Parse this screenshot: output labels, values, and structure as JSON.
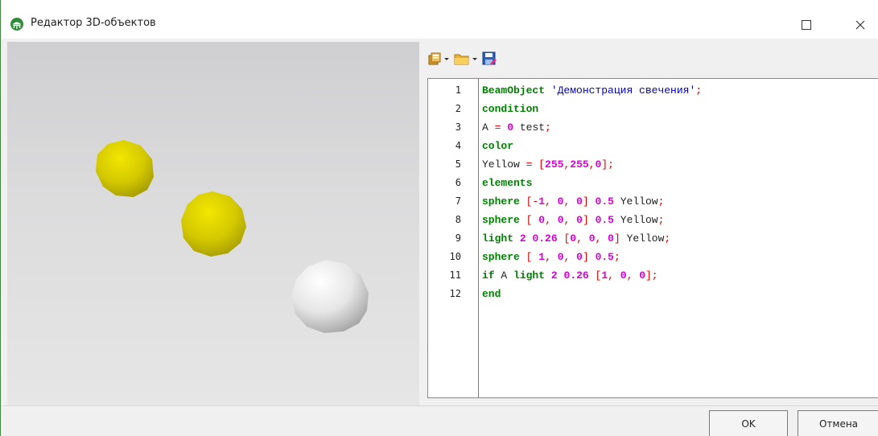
{
  "window": {
    "title": "Редактор 3D-объектов",
    "icons": {
      "app": "app-logo-icon",
      "maximize": "maximize-icon",
      "close": "close-icon"
    }
  },
  "scene": {
    "background": "#d8d8d9",
    "spheres": [
      {
        "label": "sphere-1",
        "color": "#d4c900"
      },
      {
        "label": "sphere-2",
        "color": "#d4c900"
      },
      {
        "label": "sphere-3",
        "color": "#ececec"
      }
    ]
  },
  "toolbar": {
    "items": [
      {
        "icon": "paste-templates-icon",
        "has_dropdown": true
      },
      {
        "icon": "open-folder-icon",
        "has_dropdown": true
      },
      {
        "icon": "save-icon",
        "has_dropdown": false
      }
    ]
  },
  "editor": {
    "line_numbers": [
      "1",
      "2",
      "3",
      "4",
      "5",
      "6",
      "7",
      "8",
      "9",
      "10",
      "11",
      "12"
    ],
    "lines": [
      [
        {
          "t": "kw",
          "v": "BeamObject"
        },
        {
          "t": "id",
          "v": " "
        },
        {
          "t": "str",
          "v": "'Демонстрация свечения'"
        },
        {
          "t": "op",
          "v": ";"
        }
      ],
      [
        {
          "t": "kw",
          "v": "condition"
        }
      ],
      [
        {
          "t": "id",
          "v": "A "
        },
        {
          "t": "op",
          "v": "="
        },
        {
          "t": "id",
          "v": " "
        },
        {
          "t": "num",
          "v": "0"
        },
        {
          "t": "id",
          "v": " test"
        },
        {
          "t": "op",
          "v": ";"
        }
      ],
      [
        {
          "t": "kw",
          "v": "color"
        }
      ],
      [
        {
          "t": "id",
          "v": "Yellow "
        },
        {
          "t": "op",
          "v": "="
        },
        {
          "t": "id",
          "v": " "
        },
        {
          "t": "op",
          "v": "["
        },
        {
          "t": "num",
          "v": "255"
        },
        {
          "t": "op",
          "v": ","
        },
        {
          "t": "num",
          "v": "255"
        },
        {
          "t": "op",
          "v": ","
        },
        {
          "t": "num",
          "v": "0"
        },
        {
          "t": "op",
          "v": "];"
        }
      ],
      [
        {
          "t": "kw",
          "v": "elements"
        }
      ],
      [
        {
          "t": "kw",
          "v": "sphere"
        },
        {
          "t": "id",
          "v": " "
        },
        {
          "t": "op",
          "v": "[-"
        },
        {
          "t": "num",
          "v": "1"
        },
        {
          "t": "op",
          "v": ","
        },
        {
          "t": "id",
          "v": " "
        },
        {
          "t": "num",
          "v": "0"
        },
        {
          "t": "op",
          "v": ","
        },
        {
          "t": "id",
          "v": " "
        },
        {
          "t": "num",
          "v": "0"
        },
        {
          "t": "op",
          "v": "]"
        },
        {
          "t": "id",
          "v": " "
        },
        {
          "t": "num",
          "v": "0.5"
        },
        {
          "t": "id",
          "v": " Yellow"
        },
        {
          "t": "op",
          "v": ";"
        }
      ],
      [
        {
          "t": "kw",
          "v": "sphere"
        },
        {
          "t": "id",
          "v": " "
        },
        {
          "t": "op",
          "v": "["
        },
        {
          "t": "id",
          "v": " "
        },
        {
          "t": "num",
          "v": "0"
        },
        {
          "t": "op",
          "v": ","
        },
        {
          "t": "id",
          "v": " "
        },
        {
          "t": "num",
          "v": "0"
        },
        {
          "t": "op",
          "v": ","
        },
        {
          "t": "id",
          "v": " "
        },
        {
          "t": "num",
          "v": "0"
        },
        {
          "t": "op",
          "v": "]"
        },
        {
          "t": "id",
          "v": " "
        },
        {
          "t": "num",
          "v": "0.5"
        },
        {
          "t": "id",
          "v": " Yellow"
        },
        {
          "t": "op",
          "v": ";"
        }
      ],
      [
        {
          "t": "kw",
          "v": "light"
        },
        {
          "t": "id",
          "v": " "
        },
        {
          "t": "num",
          "v": "2"
        },
        {
          "t": "id",
          "v": " "
        },
        {
          "t": "num",
          "v": "0.26"
        },
        {
          "t": "id",
          "v": " "
        },
        {
          "t": "op",
          "v": "["
        },
        {
          "t": "num",
          "v": "0"
        },
        {
          "t": "op",
          "v": ","
        },
        {
          "t": "id",
          "v": " "
        },
        {
          "t": "num",
          "v": "0"
        },
        {
          "t": "op",
          "v": ","
        },
        {
          "t": "id",
          "v": " "
        },
        {
          "t": "num",
          "v": "0"
        },
        {
          "t": "op",
          "v": "]"
        },
        {
          "t": "id",
          "v": " Yellow"
        },
        {
          "t": "op",
          "v": ";"
        }
      ],
      [
        {
          "t": "kw",
          "v": "sphere"
        },
        {
          "t": "id",
          "v": " "
        },
        {
          "t": "op",
          "v": "["
        },
        {
          "t": "id",
          "v": " "
        },
        {
          "t": "num",
          "v": "1"
        },
        {
          "t": "op",
          "v": ","
        },
        {
          "t": "id",
          "v": " "
        },
        {
          "t": "num",
          "v": "0"
        },
        {
          "t": "op",
          "v": ","
        },
        {
          "t": "id",
          "v": " "
        },
        {
          "t": "num",
          "v": "0"
        },
        {
          "t": "op",
          "v": "]"
        },
        {
          "t": "id",
          "v": " "
        },
        {
          "t": "num",
          "v": "0.5"
        },
        {
          "t": "op",
          "v": ";"
        }
      ],
      [
        {
          "t": "kw",
          "v": "if"
        },
        {
          "t": "id",
          "v": " A "
        },
        {
          "t": "kw",
          "v": "light"
        },
        {
          "t": "id",
          "v": " "
        },
        {
          "t": "num",
          "v": "2"
        },
        {
          "t": "id",
          "v": " "
        },
        {
          "t": "num",
          "v": "0.26"
        },
        {
          "t": "id",
          "v": " "
        },
        {
          "t": "op",
          "v": "["
        },
        {
          "t": "num",
          "v": "1"
        },
        {
          "t": "op",
          "v": ","
        },
        {
          "t": "id",
          "v": " "
        },
        {
          "t": "num",
          "v": "0"
        },
        {
          "t": "op",
          "v": ","
        },
        {
          "t": "id",
          "v": " "
        },
        {
          "t": "num",
          "v": "0"
        },
        {
          "t": "op",
          "v": "];"
        }
      ],
      [
        {
          "t": "kw",
          "v": "end"
        }
      ]
    ],
    "colors": {
      "keyword": "#008000",
      "string": "#0000c8",
      "number": "#d400d4",
      "operator": "#e00000"
    }
  },
  "buttons": {
    "ok": "OK",
    "cancel": "Отмена"
  }
}
